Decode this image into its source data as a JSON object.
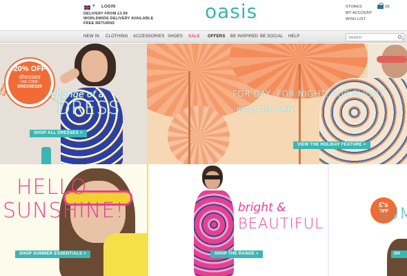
{
  "header": {
    "login": "LOGIN",
    "promo_lines": [
      "DELIVERY FROM £3.99",
      "WORLDWIDE DELIVERY AVAILABLE",
      "FREE RETURNS"
    ],
    "logo": "oasis",
    "util_links": [
      "STORES",
      "MY ACCOUNT",
      "WISH LIST"
    ],
    "bag_count": "(0)"
  },
  "nav": {
    "items": [
      "NEW IN",
      "CLOTHING",
      "ACCESSORIES",
      "SHOES",
      "SALE",
      "OFFERS",
      "BE INSPIRED",
      "BE SOCIAL",
      "HELP"
    ],
    "search_placeholder": "Search"
  },
  "hero_left": {
    "side_text": "LIMITED TIME ONLY!",
    "badge_pct": "20% OFF",
    "badge_word": "dresses",
    "badge_code_label": "USE CODE:",
    "badge_code": "DRESSES20",
    "badge_fine": "FULL PRICED ITEMS ONLY",
    "headline_small": "change of a",
    "headline_big": "DRESS",
    "cta": "SHOP ALL DRESSES >"
  },
  "hero_main": {
    "headline": "FOR DAY, FOR NIGHT, FOR FLIGHT",
    "subhead": "get jet set ready",
    "cta": "VIEW THE HOLIDAY FEATURE >"
  },
  "promo_1": {
    "line1": "HELLO",
    "line2": "SUNSHINE!",
    "cta": "SHOP SUMMER ESSENTIALS >"
  },
  "promo_2": {
    "line1": "bright &",
    "line2": "BEAUTIFUL",
    "cta": "SHOP THE RANGE >"
  },
  "promo_3": {
    "badge_amount": "£'s",
    "badge_word": "OFF",
    "headline": "SUMMER"
  },
  "colors": {
    "teal": "#3bb6b3",
    "pink": "#e8408f",
    "orange": "#f26b34"
  }
}
